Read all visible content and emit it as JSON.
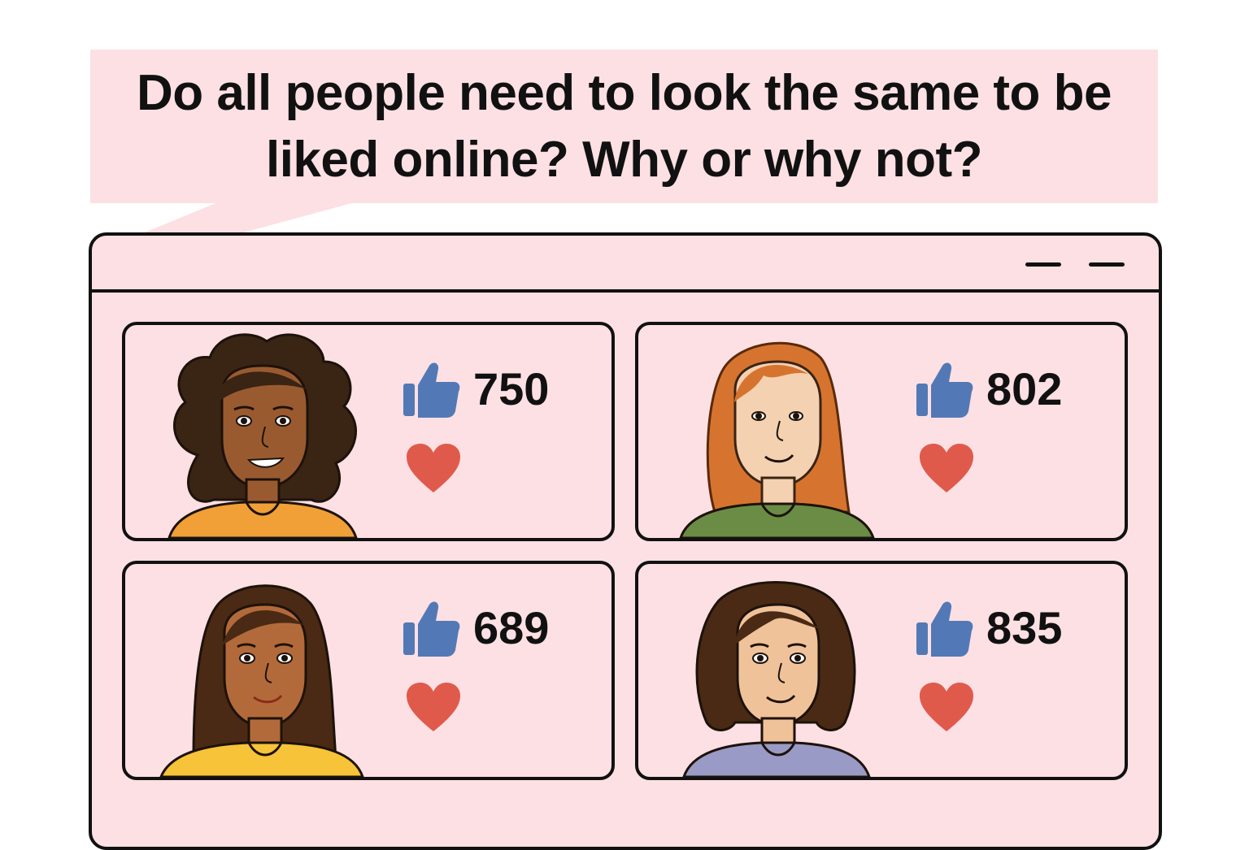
{
  "question": "Do all people need to look the same to be liked online? Why or why not?",
  "icons": {
    "like": "thumbs-up-icon",
    "love": "heart-icon"
  },
  "colors": {
    "background": "#fde0e4",
    "like": "#5279b5",
    "heart": "#e05a4c",
    "outline": "#111111"
  },
  "profiles": [
    {
      "likes": "750"
    },
    {
      "likes": "802"
    },
    {
      "likes": "689"
    },
    {
      "likes": "835"
    }
  ]
}
